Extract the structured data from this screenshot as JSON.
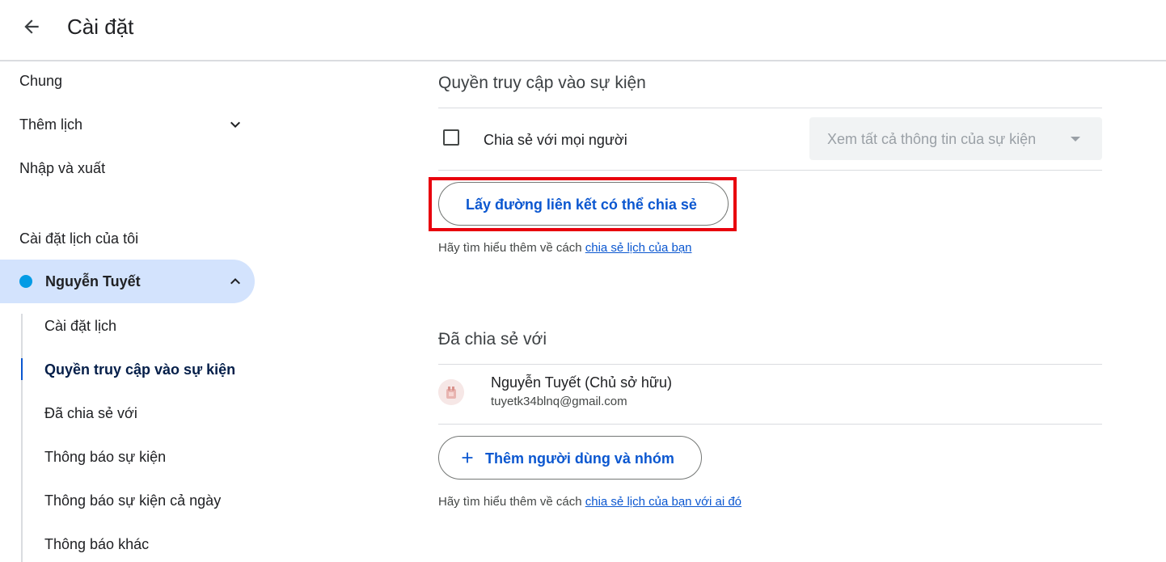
{
  "header": {
    "title": "Cài đặt"
  },
  "sidebar": {
    "general": "Chung",
    "add_calendar": "Thêm lịch",
    "import_export": "Nhập và xuất",
    "my_calendars_heading": "Cài đặt lịch của tôi",
    "calendar": {
      "name": "Nguyễn Tuyết",
      "color": "#039be5"
    },
    "sub_items": [
      {
        "label": "Cài đặt lịch"
      },
      {
        "label": "Quyền truy cập vào sự kiện",
        "active": true
      },
      {
        "label": "Đã chia sẻ với"
      },
      {
        "label": "Thông báo sự kiện"
      },
      {
        "label": "Thông báo sự kiện cả ngày"
      },
      {
        "label": "Thông báo khác"
      }
    ]
  },
  "access": {
    "title": "Quyền truy cập vào sự kiện",
    "share_public_label": "Chia sẻ với mọi người",
    "share_public_checked": false,
    "permission_select_value": "Xem tất cả thông tin của sự kiện",
    "get_link_button": "Lấy đường liên kết có thể chia sẻ",
    "help_prefix": "Hãy tìm hiểu thêm về cách",
    "help_link": "chia sẻ lịch của bạn"
  },
  "shared": {
    "title": "Đã chia sẻ với",
    "owner_name": "Nguyễn Tuyết (Chủ sở hữu)",
    "owner_email": "tuyetk34blnq@gmail.com",
    "add_button": "Thêm người dùng và nhóm",
    "help_prefix": "Hãy tìm hiểu thêm về cách",
    "help_link": "chia sẻ lịch của bạn với ai đó"
  },
  "colors": {
    "accent": "#0b57d0",
    "highlight": "#e8000d",
    "selected_bg": "#d3e3fd"
  }
}
